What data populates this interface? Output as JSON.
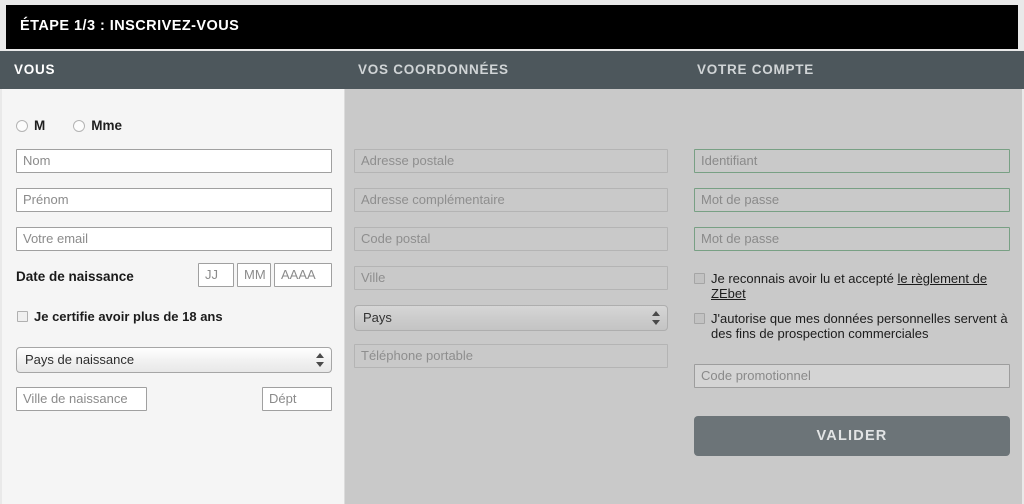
{
  "step_bar": {
    "title": "ÉTAPE 1/3 : INSCRIVEZ-VOUS"
  },
  "columns": {
    "left_header": "VOUS",
    "middle_header": "VOS COORDONNÉES",
    "right_header": "VOTRE COMPTE"
  },
  "colors": {
    "step_bar_bg": "#000000",
    "header_strip_bg": "#4d575c",
    "left_panel_bg": "#f5f5f5",
    "muted_panel_bg": "#c9c9c9",
    "green_border": "#78a084",
    "validate_button_bg": "#6c7478"
  },
  "left_column": {
    "gender": {
      "options": [
        {
          "label": "M",
          "checked": false
        },
        {
          "label": "Mme",
          "checked": false
        }
      ]
    },
    "nom": {
      "placeholder": "Nom",
      "value": ""
    },
    "prenom": {
      "placeholder": "Prénom",
      "value": ""
    },
    "email": {
      "placeholder": "Votre email",
      "value": ""
    },
    "birth_label": "Date de naissance",
    "birth_day": {
      "placeholder": "JJ",
      "value": ""
    },
    "birth_month": {
      "placeholder": "MM",
      "value": ""
    },
    "birth_year": {
      "placeholder": "AAAA",
      "value": ""
    },
    "age_check": {
      "label": "Je certifie avoir plus de 18 ans",
      "checked": false
    },
    "birth_country": {
      "selected": "Pays de naissance"
    },
    "birth_city": {
      "placeholder": "Ville de naissance",
      "value": ""
    },
    "birth_dept": {
      "placeholder": "Dépt",
      "value": ""
    }
  },
  "middle_column": {
    "address": {
      "placeholder": "Adresse postale",
      "value": ""
    },
    "address_extra": {
      "placeholder": "Adresse complémentaire",
      "value": ""
    },
    "postal_code": {
      "placeholder": "Code postal",
      "value": ""
    },
    "city": {
      "placeholder": "Ville",
      "value": ""
    },
    "country": {
      "selected": "Pays"
    },
    "mobile": {
      "placeholder": "Téléphone portable",
      "value": ""
    }
  },
  "right_column": {
    "username": {
      "placeholder": "Identifiant",
      "value": ""
    },
    "password": {
      "placeholder": "Mot de passe",
      "value": ""
    },
    "password_confirm": {
      "placeholder": "Mot de passe",
      "value": ""
    },
    "terms_check": {
      "text_before": "Je reconnais avoir lu et accepté ",
      "link_text": "le règlement de ZEbet",
      "checked": false
    },
    "marketing_check": {
      "text": "J'autorise que mes données personnelles servent à des fins de prospection commerciales",
      "checked": false
    },
    "promo_code": {
      "placeholder": "Code promotionnel",
      "value": ""
    },
    "validate_label": "VALIDER"
  }
}
